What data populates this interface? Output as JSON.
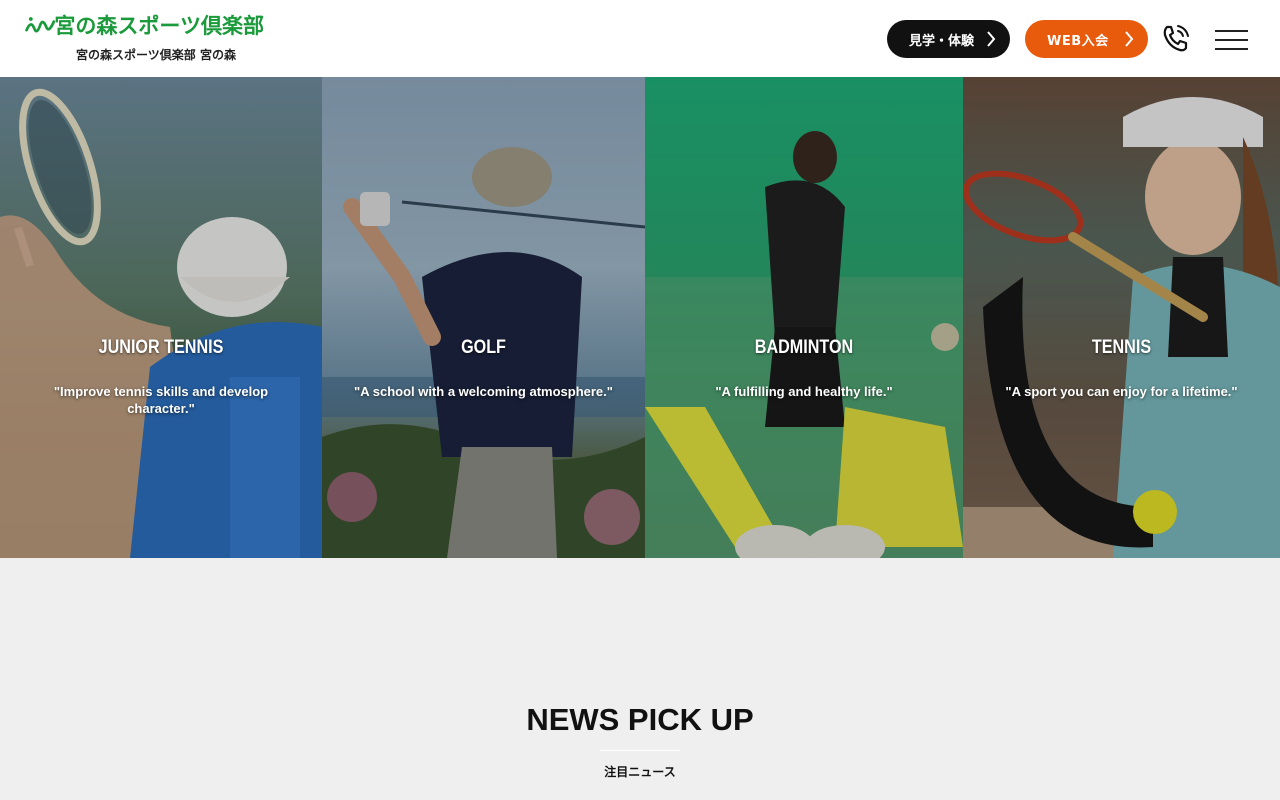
{
  "header": {
    "logo_text": "宮の森スポーツ倶楽部",
    "logo_sub": "宮の森スポーツ倶楽部 宮の森",
    "trial_button": "見学・体験",
    "join_button": "WEB入会"
  },
  "hero": {
    "panels": [
      {
        "title": "JUNIOR TENNIS",
        "quote": "\"Improve tennis skills and develop character.\""
      },
      {
        "title": "GOLF",
        "quote": "\"A school with a welcoming atmosphere.\""
      },
      {
        "title": "BADMINTON",
        "quote": "\"A fulfilling and healthy life.\""
      },
      {
        "title": "TENNIS",
        "quote": "\"A sport you can enjoy for a lifetime.\""
      }
    ]
  },
  "news": {
    "title": "NEWS PICK UP",
    "subtitle": "注目ニュース"
  },
  "colors": {
    "brand_green": "#1a9a3a",
    "accent_orange": "#e85a0c",
    "dark": "#111111",
    "page_bg": "#efefef"
  },
  "icons": [
    "logo-mark-icon",
    "chevron-right-icon",
    "phone-icon",
    "hamburger-menu-icon"
  ]
}
